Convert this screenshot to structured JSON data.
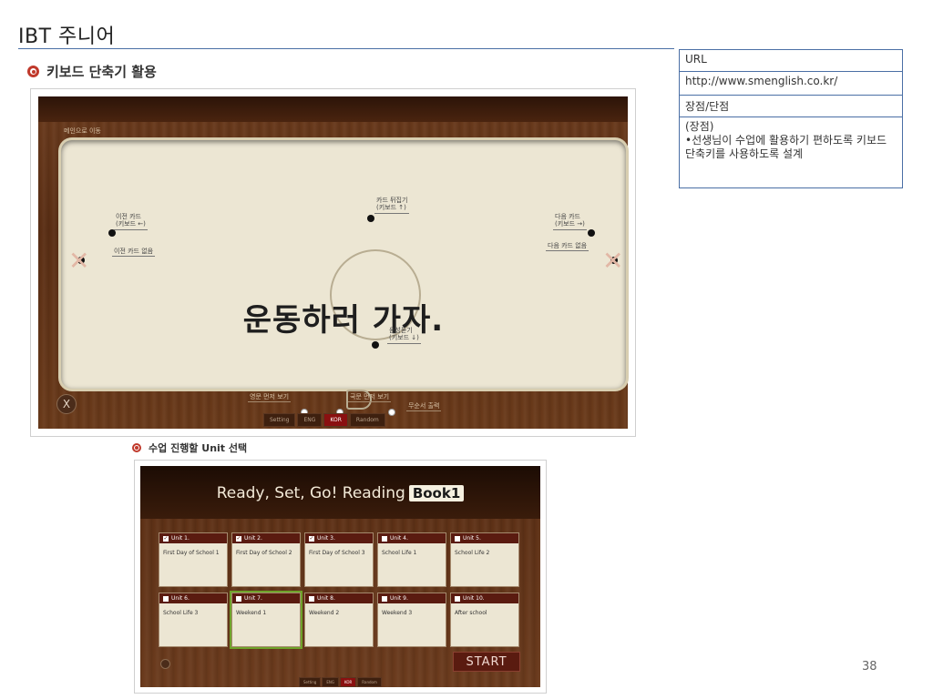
{
  "page": {
    "title": "IBT 주니어",
    "page_number": "38"
  },
  "section1": {
    "heading": "키보드 단축기 활용"
  },
  "section2": {
    "heading": "수업 진행할 Unit 선택"
  },
  "flashcard": {
    "top_label": "메인으로 이동",
    "card_text": "운동하러 가자.",
    "prev_card": "이전 카드",
    "prev_card_key": "(키보드 ←)",
    "prev_card_hide": "이전 카드 없음",
    "flip_card": "카드 뒤집기",
    "flip_card_key": "(키보드 ↑)",
    "next_card": "다음 카드",
    "next_card_key": "(키보드 →)",
    "next_card_hide": "다음 카드 없음",
    "sound": "음성듣기",
    "sound_key": "(키보드 ↓)",
    "eng_first": "영문 먼저 보기",
    "kor_first": "국문 먼저 보기",
    "random": "무순서 출력",
    "exit_label": "X",
    "tabs": [
      "Setting",
      "ENG",
      "KOR",
      "Random"
    ]
  },
  "unit_select": {
    "title": "Ready, Set, Go! Reading",
    "book": "Book1",
    "start": "START",
    "units": [
      {
        "label": "Unit 1.",
        "name": "First Day of School 1",
        "checked": true
      },
      {
        "label": "Unit 2.",
        "name": "First Day of School 2",
        "checked": true
      },
      {
        "label": "Unit 3.",
        "name": "First Day of School 3",
        "checked": true
      },
      {
        "label": "Unit 4.",
        "name": "School Life 1",
        "checked": false
      },
      {
        "label": "Unit 5.",
        "name": "School Life 2",
        "checked": false
      },
      {
        "label": "Unit 6.",
        "name": "School Life 3",
        "checked": false
      },
      {
        "label": "Unit 7.",
        "name": "Weekend 1",
        "checked": false
      },
      {
        "label": "Unit 8.",
        "name": "Weekend 2",
        "checked": false
      },
      {
        "label": "Unit 9.",
        "name": "Weekend 3",
        "checked": false
      },
      {
        "label": "Unit 10.",
        "name": "After school",
        "checked": false
      }
    ],
    "tabs": [
      "Setting",
      "ENG",
      "KOR",
      "Random"
    ]
  },
  "info_table": {
    "url_header": "URL",
    "url_value": "http://www.smenglish.co.kr/",
    "proscons_header": "장점/단점",
    "pros_title": "(장점)",
    "pros_body": "•선생님이 수업에 활용하기 편하도록 키보드 단축키를 사용하도록 설계"
  }
}
